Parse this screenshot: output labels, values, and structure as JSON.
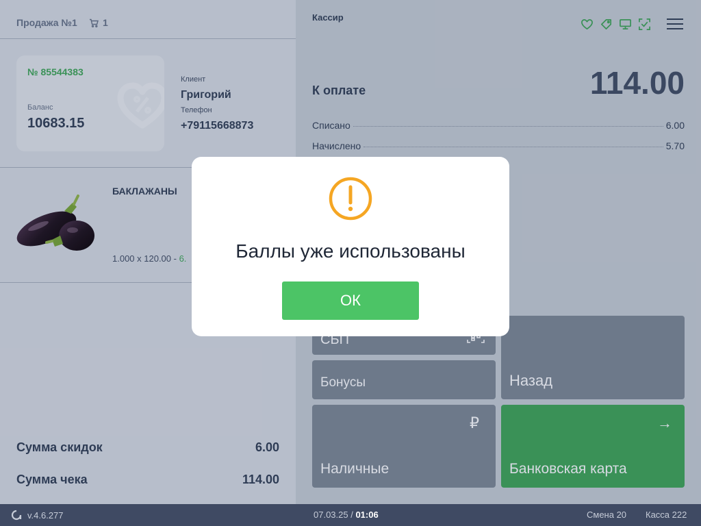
{
  "sale": {
    "title": "Продажа №1",
    "cart_count": "1"
  },
  "card": {
    "number": "№ 85544383",
    "balance_label": "Баланс",
    "balance": "10683.15"
  },
  "client": {
    "client_label": "Клиент",
    "name": "Григорий",
    "phone_label": "Телефон",
    "phone": "+79115668873"
  },
  "product": {
    "name": "БАКЛАЖАНЫ",
    "qty_text": "1.000 x 120.00 - ",
    "qty_discount": "6."
  },
  "totals": {
    "discount_label": "Сумма скидок",
    "discount_value": "6.00",
    "check_label": "Сумма чека",
    "check_value": "114.00"
  },
  "payment": {
    "cashier": "Кассир",
    "to_pay_label": "К оплате",
    "to_pay_value": "114.00",
    "written_off_label": "Списано",
    "written_off_value": "6.00",
    "accrued_label": "Начислено",
    "accrued_value": "5.70"
  },
  "icons": [
    "heart-icon",
    "tag-icon",
    "monitor-icon",
    "scan-check-icon",
    "menu-icon"
  ],
  "tiles": {
    "sbp": "СБП",
    "bonuses": "Бонусы",
    "back": "Назад",
    "cash": "Наличные",
    "card": "Банковская карта"
  },
  "footer": {
    "version": "v.4.6.277",
    "date": "07.03.25",
    "time": "01:06",
    "shift": "Смена 20",
    "till": "Касса 222"
  },
  "dialog": {
    "message": "Баллы уже использованы",
    "button": "ОК"
  },
  "colors": {
    "accent_green": "#3c9a58",
    "button_green": "#4cc466",
    "warning_orange": "#f5a623",
    "footer_bg": "#3f4a63"
  }
}
